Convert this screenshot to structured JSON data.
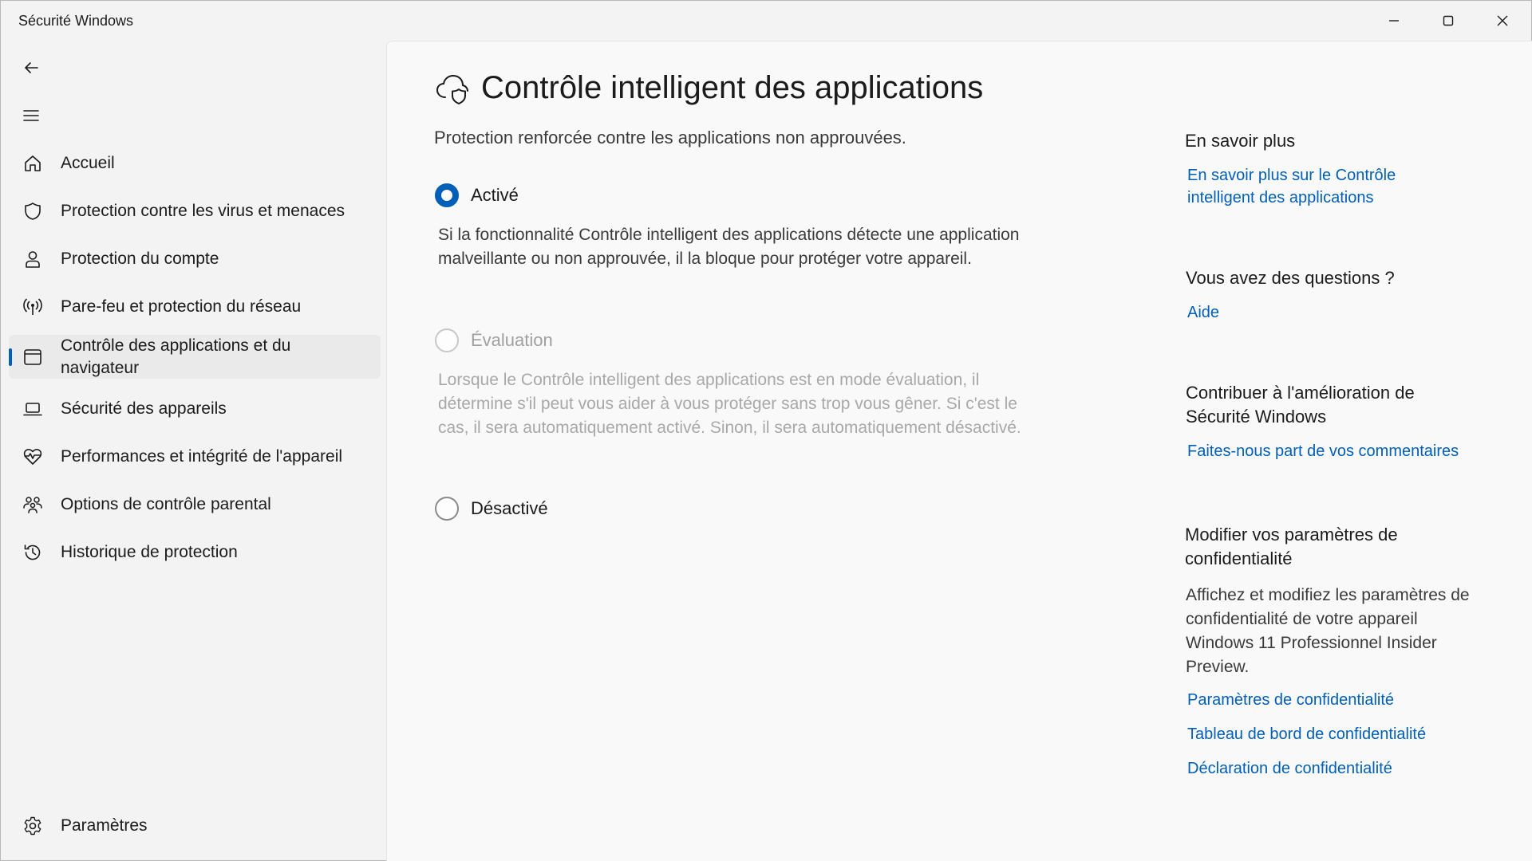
{
  "window": {
    "title": "Sécurité Windows"
  },
  "sidebar": {
    "items": [
      {
        "label": "Accueil",
        "icon": "home-icon"
      },
      {
        "label": "Protection contre les virus et menaces",
        "icon": "shield-icon"
      },
      {
        "label": "Protection du compte",
        "icon": "person-icon"
      },
      {
        "label": "Pare-feu et protection du réseau",
        "icon": "wireless-icon"
      },
      {
        "label": "Contrôle des applications et du navigateur",
        "icon": "app-window-icon",
        "selected": true
      },
      {
        "label": "Sécurité des appareils",
        "icon": "laptop-icon"
      },
      {
        "label": "Performances et intégrité de l'appareil",
        "icon": "heart-pulse-icon"
      },
      {
        "label": "Options de contrôle parental",
        "icon": "family-icon"
      },
      {
        "label": "Historique de protection",
        "icon": "history-icon"
      }
    ],
    "settings_label": "Paramètres"
  },
  "main": {
    "title": "Contrôle intelligent des applications",
    "description": "Protection renforcée contre les applications non approuvées.",
    "options": [
      {
        "label": "Activé",
        "state": "checked",
        "description": "Si la fonctionnalité Contrôle intelligent des applications détecte une application malveillante ou non approuvée, il la bloque pour protéger votre appareil."
      },
      {
        "label": "Évaluation",
        "state": "disabled",
        "description": "Lorsque le Contrôle intelligent des applications est en mode évaluation, il détermine s'il peut vous aider à vous protéger sans trop vous gêner. Si c'est le cas, il sera automatiquement activé. Sinon, il sera automatiquement désactivé."
      },
      {
        "label": "Désactivé",
        "state": "unchecked"
      }
    ]
  },
  "side": {
    "learn_more": {
      "heading": "En savoir plus",
      "link": "En savoir plus sur le Contrôle intelligent des applications"
    },
    "questions": {
      "heading": "Vous avez des questions ?",
      "link": "Aide"
    },
    "contribute": {
      "heading": "Contribuer à l'amélioration de Sécurité Windows",
      "link": "Faites-nous part de vos commentaires"
    },
    "privacy": {
      "heading": "Modifier vos paramètres de confidentialité",
      "text": "Affichez et modifiez les paramètres de confidentialité de votre appareil Windows 11 Professionnel Insider Preview.",
      "links": [
        "Paramètres de confidentialité",
        "Tableau de bord de confidentialité",
        "Déclaration de confidentialité"
      ]
    }
  },
  "colors": {
    "accent": "#005fb8",
    "background": "#f3f3f3",
    "content_bg": "#f9f9f9"
  }
}
